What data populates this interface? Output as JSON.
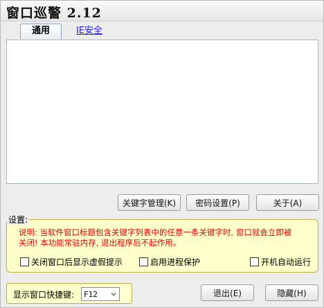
{
  "window": {
    "title": "窗口巡警 2.12"
  },
  "tabs": [
    {
      "label": "通用",
      "active": true
    },
    {
      "label": "IE安全",
      "active": false
    }
  ],
  "buttons": {
    "keyword": "关键字管理(K)",
    "password": "密码设置(P)",
    "about": "关于(A)",
    "exit": "退出(E)",
    "hide": "隐藏(H)"
  },
  "settings": {
    "legend": "设置:",
    "note_line1": "说明: 当软件窗口标题包含关键字列表中的任意一条关键字时, 窗口就会立即被",
    "note_line2": "关闭! 本功能常驻内存, 退出程序后不起作用。",
    "checkboxes": [
      {
        "label": "关闭窗口后显示虚假提示",
        "checked": false
      },
      {
        "label": "启用进程保护",
        "checked": false
      },
      {
        "label": "开机自动运行",
        "checked": false
      }
    ]
  },
  "hotkey": {
    "label": "显示窗口快捷键:",
    "value": "F12"
  },
  "colors": {
    "note_text": "#e00000",
    "settings_bg": "#ffffcc",
    "link": "#1a1aff"
  }
}
